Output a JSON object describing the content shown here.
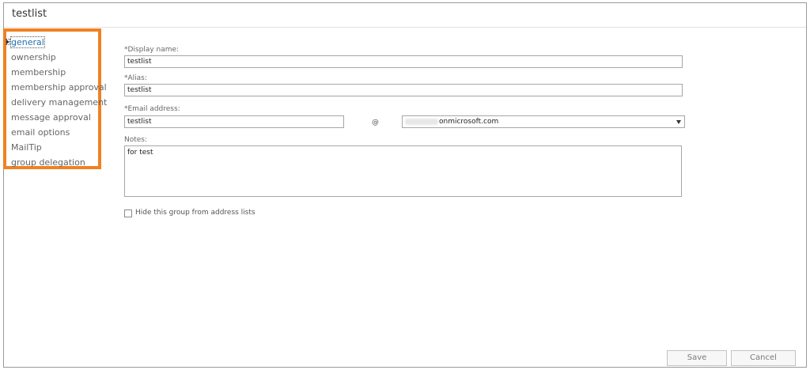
{
  "window": {
    "title": "testlist"
  },
  "nav": {
    "items": [
      {
        "label": "general",
        "selected": true
      },
      {
        "label": "ownership"
      },
      {
        "label": "membership"
      },
      {
        "label": "membership approval"
      },
      {
        "label": "delivery management"
      },
      {
        "label": "message approval"
      },
      {
        "label": "email options"
      },
      {
        "label": "MailTip"
      },
      {
        "label": "group delegation"
      }
    ],
    "highlight_color": "#f18122",
    "selected_color": "#1f6fb2"
  },
  "form": {
    "display_name": {
      "label": "*Display name:",
      "value": "testlist"
    },
    "alias": {
      "label": "*Alias:",
      "value": "testlist"
    },
    "email": {
      "label": "*Email address:",
      "value": "testlist",
      "at": "@",
      "domain_visible": "onmicrosoft.com"
    },
    "notes": {
      "label": "Notes:",
      "value": "for test"
    },
    "hide_from_lists": {
      "label": "Hide this group from address lists",
      "checked": false
    }
  },
  "footer": {
    "save_label": "Save",
    "cancel_label": "Cancel"
  }
}
